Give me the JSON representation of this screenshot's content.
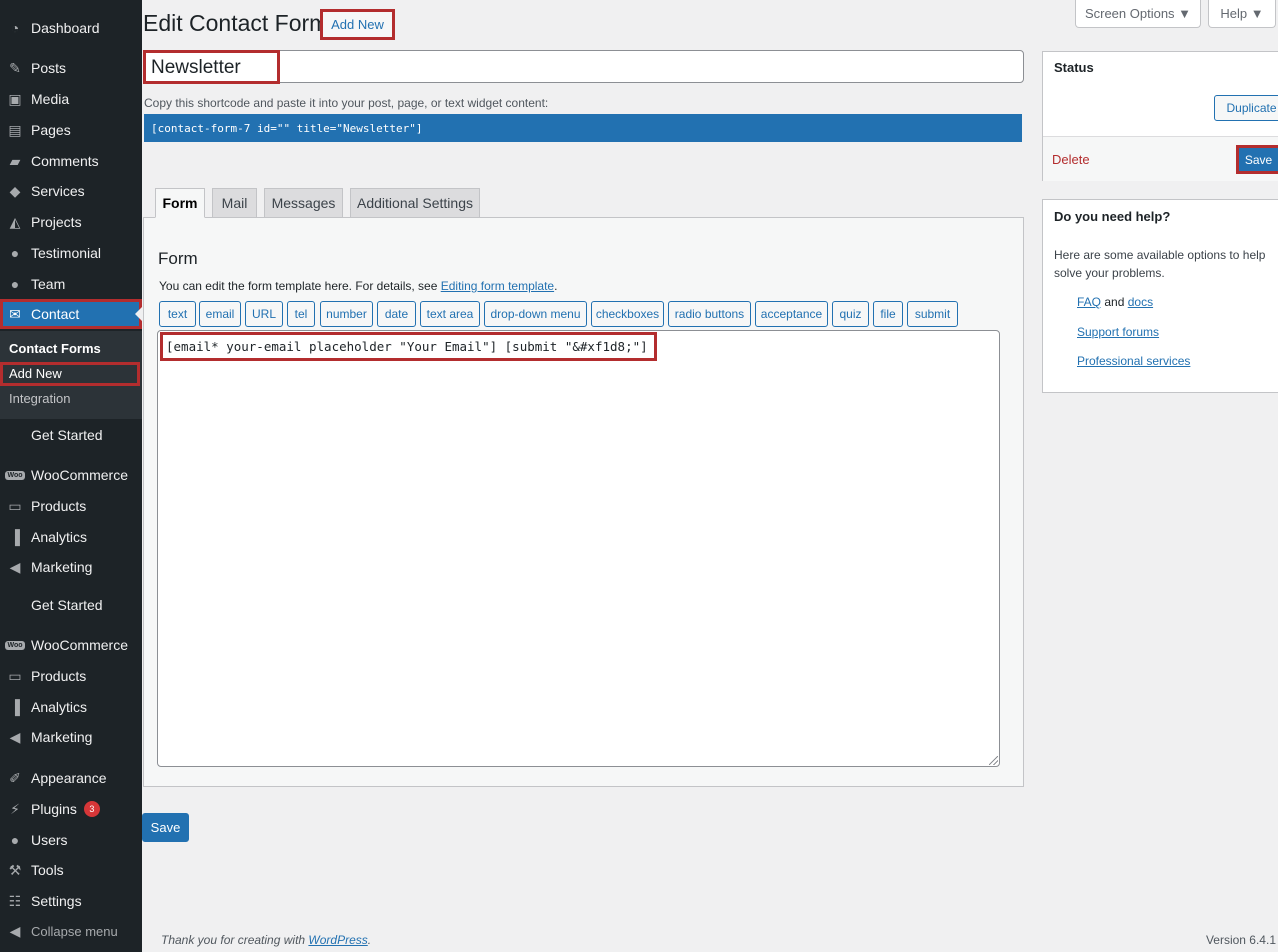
{
  "sidebar": {
    "items": [
      {
        "label": "Dashboard",
        "icon": "dashboard-icon"
      },
      {
        "label": "Posts",
        "icon": "pin-icon"
      },
      {
        "label": "Media",
        "icon": "media-icon"
      },
      {
        "label": "Pages",
        "icon": "pages-icon"
      },
      {
        "label": "Comments",
        "icon": "comment-icon"
      },
      {
        "label": "Services",
        "icon": "tag-icon"
      },
      {
        "label": "Projects",
        "icon": "mortarboard-icon"
      },
      {
        "label": "Testimonial",
        "icon": "person-icon"
      },
      {
        "label": "Team",
        "icon": "person-icon"
      },
      {
        "label": "Contact",
        "icon": "mail-icon"
      }
    ],
    "submenu": {
      "contact_forms": "Contact Forms",
      "add_new": "Add New",
      "integration": "Integration"
    },
    "items_lower": [
      {
        "label": "Get Started"
      },
      {
        "label": "WooCommerce",
        "icon": "woo-icon"
      },
      {
        "label": "Products",
        "icon": "archive-icon"
      },
      {
        "label": "Analytics",
        "icon": "bar-chart-icon"
      },
      {
        "label": "Marketing",
        "icon": "megaphone-icon"
      },
      {
        "label": "Get Started"
      },
      {
        "label": "WooCommerce",
        "icon": "woo-icon"
      },
      {
        "label": "Products",
        "icon": "archive-icon"
      },
      {
        "label": "Analytics",
        "icon": "bar-chart-icon"
      },
      {
        "label": "Marketing",
        "icon": "megaphone-icon"
      },
      {
        "label": "Appearance",
        "icon": "brush-icon"
      },
      {
        "label": "Plugins",
        "icon": "plug-icon",
        "badge": "3"
      },
      {
        "label": "Users",
        "icon": "person-icon"
      },
      {
        "label": "Tools",
        "icon": "wrench-icon"
      },
      {
        "label": "Settings",
        "icon": "sliders-icon"
      },
      {
        "label": "Collapse menu",
        "icon": "collapse-icon"
      }
    ]
  },
  "header": {
    "title": "Edit Contact Form",
    "add_new": "Add New",
    "screen_options": "Screen Options ▼",
    "help": "Help ▼"
  },
  "form": {
    "title_value": "Newsletter",
    "shortcode_hint": "Copy this shortcode and paste it into your post, page, or text widget content:",
    "shortcode": "[contact-form-7 id=\"\" title=\"Newsletter\"]"
  },
  "tabs": [
    "Form",
    "Mail",
    "Messages",
    "Additional Settings"
  ],
  "form_panel": {
    "heading": "Form",
    "description": "You can edit the form template here. For details, see ",
    "description_link": "Editing form template",
    "description_end": ".",
    "tag_buttons": [
      "text",
      "email",
      "URL",
      "tel",
      "number",
      "date",
      "text area",
      "drop-down menu",
      "checkboxes",
      "radio buttons",
      "acceptance",
      "quiz",
      "file",
      "submit"
    ],
    "template": "[email* your-email placeholder \"Your Email\"] [submit \"&#xf1d8;\"]"
  },
  "save_bottom": "Save",
  "status_box": {
    "title": "Status",
    "duplicate": "Duplicate",
    "delete": "Delete",
    "save": "Save"
  },
  "help_box": {
    "title": "Do you need help?",
    "text": "Here are some available options to help solve your problems.",
    "faq": "FAQ",
    "and": " and ",
    "docs": "docs",
    "support": "Support forums",
    "professional": "Professional services"
  },
  "footer": {
    "thanks": "Thank you for creating with ",
    "wordpress": "WordPress",
    "thanks_end": ".",
    "version": "Version 6.4.1"
  }
}
